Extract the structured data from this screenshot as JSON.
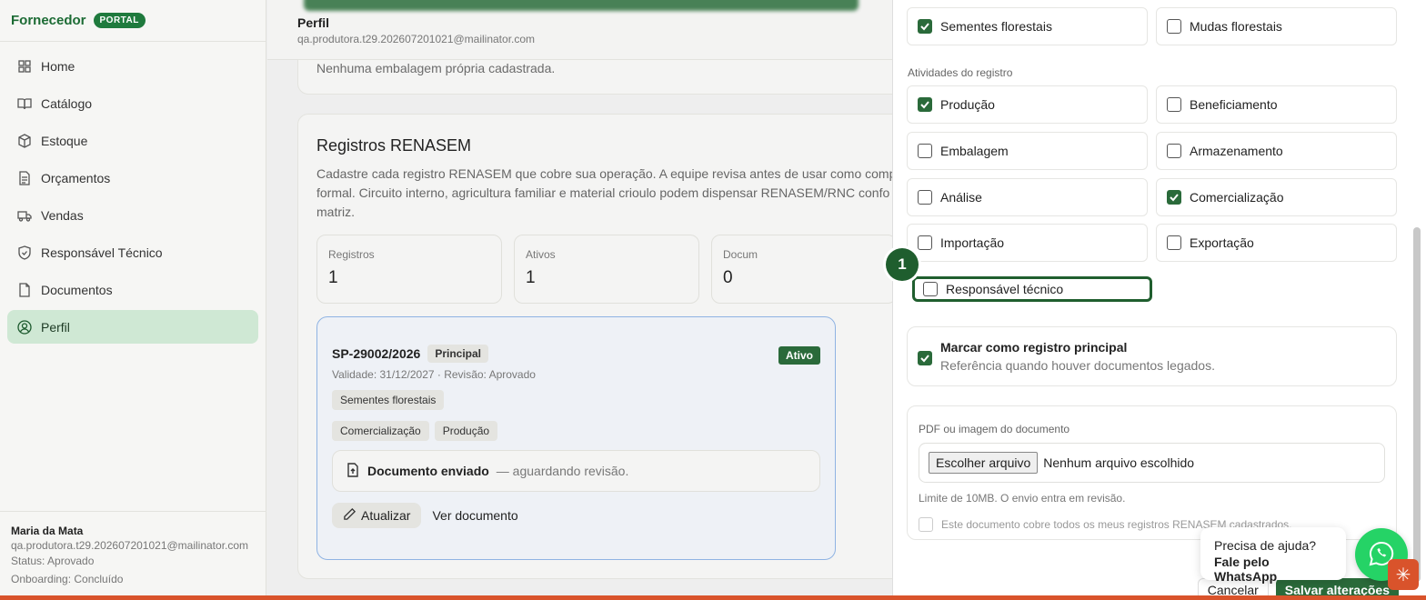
{
  "brand": {
    "name": "Fornecedor",
    "badge": "PORTAL"
  },
  "sidebar": {
    "items": [
      {
        "label": "Home",
        "icon": "home-icon"
      },
      {
        "label": "Catálogo",
        "icon": "book-icon"
      },
      {
        "label": "Estoque",
        "icon": "box-icon"
      },
      {
        "label": "Orçamentos",
        "icon": "document-icon"
      },
      {
        "label": "Vendas",
        "icon": "truck-icon"
      },
      {
        "label": "Responsável Técnico",
        "icon": "shield-icon"
      },
      {
        "label": "Documentos",
        "icon": "file-icon"
      },
      {
        "label": "Perfil",
        "icon": "user-circle-icon",
        "active": true
      }
    ]
  },
  "user": {
    "name": "Maria da Mata",
    "email": "qa.produtora.t29.202607201021@mailinator.com",
    "status": "Status: Aprovado",
    "onboarding": "Onboarding: Concluído"
  },
  "header": {
    "title": "Perfil",
    "email": "qa.produtora.t29.202607201021@mailinator.com"
  },
  "packaging": {
    "empty": "Nenhuma embalagem própria cadastrada."
  },
  "renasem": {
    "title": "Registros RENASEM",
    "desc1": "Cadastre cada registro RENASEM que cobre sua operação. A equipe revisa antes de usar como comp",
    "desc2": "formal. Circuito interno, agricultura familiar e material crioulo podem dispensar RENASEM/RNC confo",
    "desc3": "matriz.",
    "stats": [
      {
        "label": "Registros",
        "value": "1"
      },
      {
        "label": "Ativos",
        "value": "1"
      },
      {
        "label": "Docum",
        "value": "0"
      }
    ],
    "record": {
      "code": "SP-29002/2026",
      "badge": "Principal",
      "status": "Ativo",
      "meta": "Validade: 31/12/2027 · Revisão: Aprovado",
      "tags": [
        "Sementes florestais",
        "Comercialização",
        "Produção"
      ],
      "doc_strong": "Documento enviado",
      "doc_muted": "— aguardando revisão.",
      "update_label": "Atualizar",
      "view_label": "Ver documento"
    }
  },
  "drawer": {
    "types": [
      {
        "label": "Sementes florestais",
        "checked": true
      },
      {
        "label": "Mudas florestais",
        "checked": false
      }
    ],
    "activities_label": "Atividades do registro",
    "activities": [
      {
        "label": "Produção",
        "checked": true
      },
      {
        "label": "Beneficiamento",
        "checked": false
      },
      {
        "label": "Embalagem",
        "checked": false
      },
      {
        "label": "Armazenamento",
        "checked": false
      },
      {
        "label": "Análise",
        "checked": false
      },
      {
        "label": "Comercialização",
        "checked": true
      },
      {
        "label": "Importação",
        "checked": false
      },
      {
        "label": "Exportação",
        "checked": false
      },
      {
        "label": "Responsável técnico",
        "checked": false
      }
    ],
    "marker": "1",
    "principal_title": "Marcar como registro principal",
    "principal_sub": "Referência quando houver documentos legados.",
    "upload_label": "PDF ou imagem do documento",
    "file_button": "Escolher arquivo",
    "file_name": "Nenhum arquivo escolhido",
    "hint": "Limite de 10MB. O envio entra em revisão.",
    "cover_label": "Este documento cobre todos os meus registros RENASEM cadastrados.",
    "cancel": "Cancelar",
    "save": "Salvar alterações"
  },
  "help": {
    "question": "Precisa de ajuda?",
    "action": "Fale pelo WhatsApp"
  },
  "colors": {
    "brand": "#1f7a3d",
    "accent": "#2a6a3a",
    "whatsapp": "#25d366",
    "orange": "#d9532b"
  }
}
